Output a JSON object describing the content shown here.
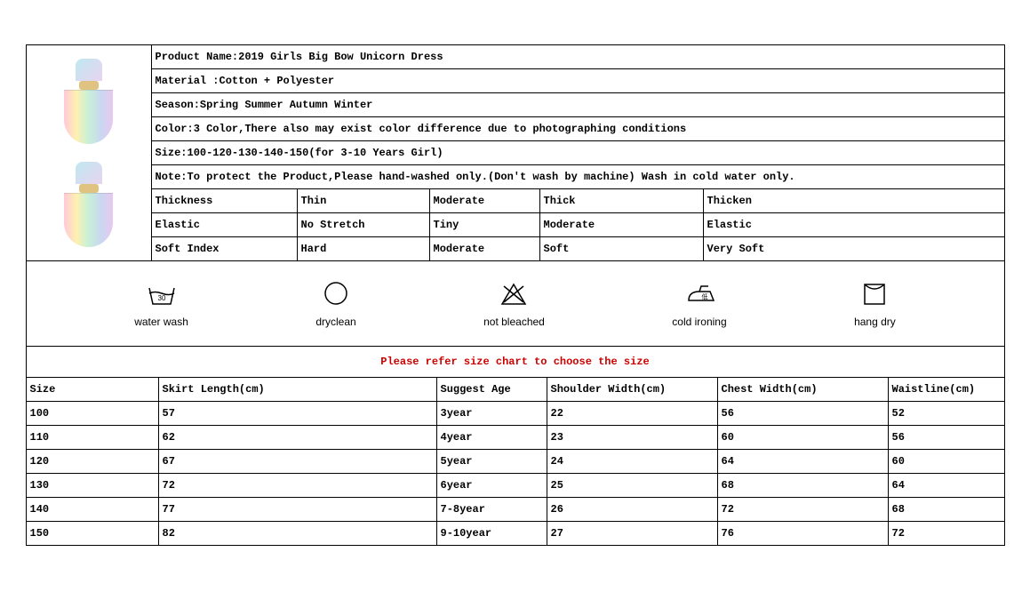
{
  "product": {
    "name_label": "Product Name:2019 Girls Big Bow Unicorn Dress",
    "material": "Material :Cotton + Polyester",
    "season": "Season:Spring Summer Autumn Winter",
    "color": "Color:3 Color,There also may exist color difference due to photographing conditions",
    "size": "Size:100-120-130-140-150(for 3-10 Years Girl)",
    "note": "Note:To protect the Product,Please hand-washed only.(Don't wash by machine) Wash in cold water only."
  },
  "attributes": {
    "rows": [
      {
        "label": "Thickness",
        "v1": "Thin",
        "v2": "Moderate",
        "v3": "Thick",
        "v4": "Thicken"
      },
      {
        "label": "Elastic",
        "v1": "No Stretch",
        "v2": "Tiny",
        "v3": "Moderate",
        "v4": "Elastic"
      },
      {
        "label": "Soft Index",
        "v1": "Hard",
        "v2": "Moderate",
        "v3": "Soft",
        "v4": "Very Soft"
      }
    ]
  },
  "care": {
    "items": [
      {
        "icon": "wash",
        "label": "water wash"
      },
      {
        "icon": "dryclean",
        "label": "dryclean"
      },
      {
        "icon": "bleach",
        "label": "not bleached"
      },
      {
        "icon": "iron",
        "label": "cold ironing"
      },
      {
        "icon": "hang",
        "label": "hang dry"
      }
    ]
  },
  "size_chart": {
    "refer_text": "Please refer size chart to choose the size",
    "headers": {
      "h1": "Size",
      "h2": "Skirt Length(cm)",
      "h3": "Suggest Age",
      "h4": "Shoulder Width(cm)",
      "h5": "Chest Width(cm)",
      "h6": "Waistline(cm)"
    },
    "rows": [
      {
        "c1": "100",
        "c2": "57",
        "c3": "3year",
        "c4": "22",
        "c5": "56",
        "c6": "52"
      },
      {
        "c1": "110",
        "c2": "62",
        "c3": "4year",
        "c4": "23",
        "c5": "60",
        "c6": "56"
      },
      {
        "c1": "120",
        "c2": "67",
        "c3": "5year",
        "c4": "24",
        "c5": "64",
        "c6": "60"
      },
      {
        "c1": "130",
        "c2": "72",
        "c3": "6year",
        "c4": "25",
        "c5": "68",
        "c6": "64"
      },
      {
        "c1": "140",
        "c2": "77",
        "c3": "7-8year",
        "c4": "26",
        "c5": "72",
        "c6": "68"
      },
      {
        "c1": "150",
        "c2": "82",
        "c3": "9-10year",
        "c4": "27",
        "c5": "76",
        "c6": "72"
      }
    ]
  }
}
